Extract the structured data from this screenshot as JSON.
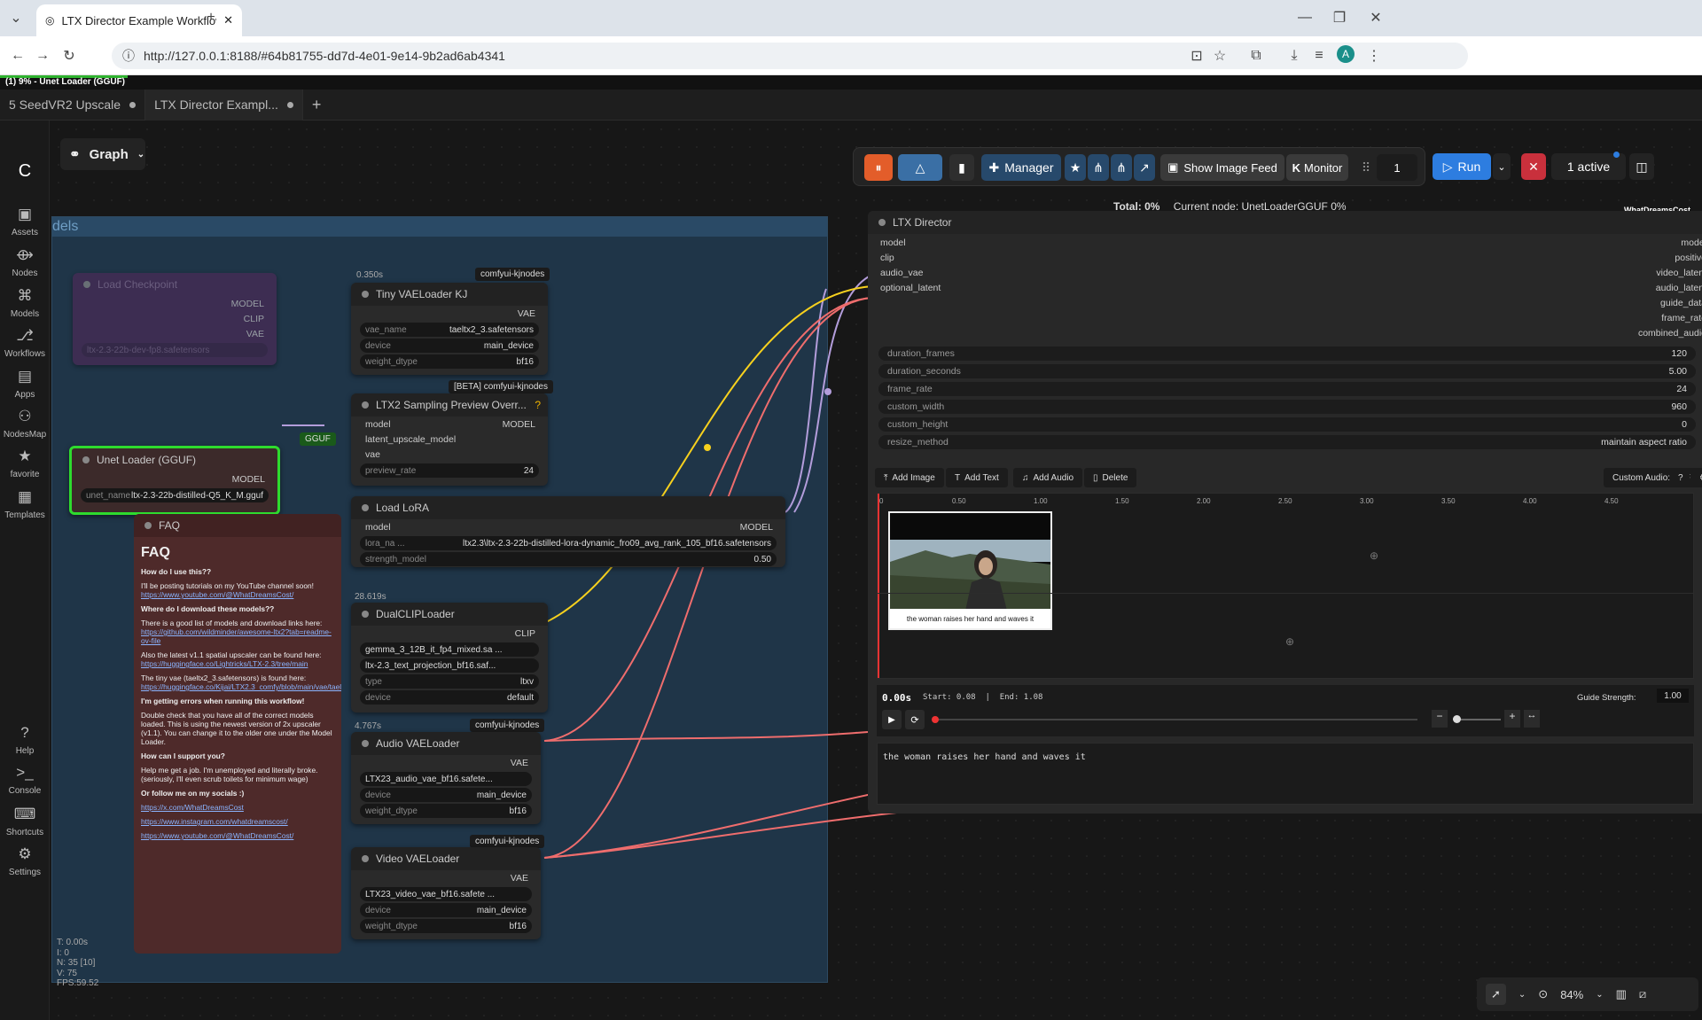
{
  "browser": {
    "tab_title": "LTX Director Example Workflow",
    "url": "http://127.0.0.1:8188/#64b81755-dd7d-4e01-9e14-9b2ad6ab4341",
    "profile": "A"
  },
  "progress": {
    "label": "(1) 9% - Unet Loader (GGUF)",
    "percent": 9
  },
  "workflow_tabs": [
    "5 SeedVR2 Upscale",
    "LTX Director Exampl..."
  ],
  "graph_label": "Graph",
  "sidebar": [
    {
      "label": "Assets",
      "icon": "assets-icon"
    },
    {
      "label": "Nodes",
      "icon": "nodes-icon"
    },
    {
      "label": "Models",
      "icon": "models-icon"
    },
    {
      "label": "Workflows",
      "icon": "workflows-icon"
    },
    {
      "label": "Apps",
      "icon": "apps-icon"
    },
    {
      "label": "NodesMap",
      "icon": "nodesmap-icon"
    },
    {
      "label": "favorite",
      "icon": "star-icon"
    },
    {
      "label": "Templates",
      "icon": "templates-icon"
    },
    {
      "label": "Help",
      "icon": "help-icon"
    },
    {
      "label": "Console",
      "icon": "console-icon"
    },
    {
      "label": "Shortcuts",
      "icon": "keyboard-icon"
    },
    {
      "label": "Settings",
      "icon": "gear-icon"
    }
  ],
  "toolbar": {
    "manager": "Manager",
    "image_feed": "Show Image Feed",
    "monitor": "Monitor",
    "queue_count": "1",
    "run": "Run",
    "active": "1 active"
  },
  "status": {
    "total": "Total: 0%",
    "current": "Current node: UnetLoaderGGUF 0%",
    "brand": "WhatDreamsCost"
  },
  "group_title": "dels",
  "nodes": {
    "load_checkpoint": {
      "title": "Load Checkpoint",
      "outputs": [
        "MODEL",
        "CLIP",
        "VAE"
      ],
      "ckpt": "ltx-2.3-22b-dev-fp8.safetensors"
    },
    "unet_loader": {
      "badge": "GGUF",
      "title": "Unet Loader (GGUF)",
      "output": "MODEL",
      "w_label": "unet_name",
      "w_value": "ltx-2.3-22b-distilled-Q5_K_M.gguf"
    },
    "tiny_vae": {
      "time": "0.350s",
      "tag": "comfyui-kjnodes",
      "title": "Tiny VAELoader KJ",
      "output": "VAE",
      "widgets": [
        [
          "vae_name",
          "taeltx2_3.safetensors"
        ],
        [
          "device",
          "main_device"
        ],
        [
          "weight_dtype",
          "bf16"
        ]
      ]
    },
    "ltx2_preview": {
      "tag": "[BETA] comfyui-kjnodes",
      "title": "LTX2 Sampling Preview Overr...",
      "inputs": [
        "model",
        "latent_upscale_model",
        "vae"
      ],
      "output": "MODEL",
      "widget": [
        "preview_rate",
        "24"
      ]
    },
    "load_lora": {
      "title": "Load LoRA",
      "input": "model",
      "output": "MODEL",
      "widgets": [
        [
          "lora_na ...",
          "ltx2.3\\ltx-2.3-22b-distilled-lora-dynamic_fro09_avg_rank_105_bf16.safetensors"
        ],
        [
          "strength_model",
          "0.50"
        ]
      ],
      "time": "28.619s"
    },
    "dual_clip": {
      "title": "DualCLIPLoader",
      "output": "CLIP",
      "widgets": [
        [
          "",
          "gemma_3_12B_it_fp4_mixed.sa ..."
        ],
        [
          "",
          "ltx-2.3_text_projection_bf16.saf..."
        ],
        [
          "type",
          "ltxv"
        ],
        [
          "device",
          "default"
        ]
      ]
    },
    "audio_vae": {
      "time": "4.767s",
      "tag": "comfyui-kjnodes",
      "title": "Audio VAELoader",
      "output": "VAE",
      "widgets": [
        [
          "",
          "LTX23_audio_vae_bf16.safete..."
        ],
        [
          "device",
          "main_device"
        ],
        [
          "weight_dtype",
          "bf16"
        ]
      ]
    },
    "video_vae": {
      "tag": "comfyui-kjnodes",
      "title": "Video VAELoader",
      "output": "VAE",
      "widgets": [
        [
          "",
          "LTX23_video_vae_bf16.safete ..."
        ],
        [
          "device",
          "main_device"
        ],
        [
          "weight_dtype",
          "bf16"
        ]
      ]
    }
  },
  "faq": {
    "title_small": "FAQ",
    "title": "FAQ",
    "items": [
      {
        "q": "How do I use this??",
        "a": "I'll be posting tutorials on my YouTube channel soon!",
        "link": "https://www.youtube.com/@WhatDreamsCost/"
      },
      {
        "q": "Where do I download these models??",
        "a": "There is a good list of models and download links here:",
        "link": "https://github.com/wildminder/awesome-ltx2?tab=readme-ov-file"
      },
      {
        "q": "",
        "a": "Also the latest v1.1 spatial upscaler can be found here:",
        "link": "https://huggingface.co/Lightricks/LTX-2.3/tree/main"
      },
      {
        "q": "",
        "a": "The tiny vae (taeltx2_3.safetensors) is found here:",
        "link": "https://huggingface.co/Kijai/LTX2.3_comfy/blob/main/vae/taeltx2_3.safetensors"
      },
      {
        "q": "I'm getting errors when running this workflow!",
        "a": "Double check that you have all of the correct models loaded. This is using the newest version of 2x upscaler (v1.1). You can change it to the older one under the Model Loader.",
        "link": ""
      },
      {
        "q": "How can I support you?",
        "a": "Help me get a job. I'm unemployed and literally broke. (seriously, I'll even scrub toilets for minimum wage)",
        "link": ""
      },
      {
        "q": "Or follow me on my socials :)",
        "a": "",
        "link": "https://x.com/WhatDreamsCost"
      }
    ],
    "extra_links": [
      "https://www.instagram.com/whatdreamscost/",
      "https://www.youtube.com/@WhatDreamsCost/"
    ]
  },
  "director": {
    "title": "LTX Director",
    "inputs": [
      "model",
      "clip",
      "audio_vae",
      "optional_latent"
    ],
    "outputs": [
      "model",
      "positive",
      "video_latent",
      "audio_latent",
      "guide_data",
      "frame_rate",
      "combined_audio"
    ],
    "widgets": [
      [
        "duration_frames",
        "120"
      ],
      [
        "duration_seconds",
        "5.00"
      ],
      [
        "frame_rate",
        "24"
      ],
      [
        "custom_width",
        "960"
      ],
      [
        "custom_height",
        "0"
      ],
      [
        "resize_method",
        "maintain aspect ratio"
      ]
    ],
    "buttons": [
      "Add Image",
      "Add Text",
      "Add Audio",
      "Delete"
    ],
    "custom_audio": "Custom Audio: OFF",
    "help": "?",
    "ruler": [
      "0",
      "0.50",
      "1.00",
      "1.50",
      "2.00",
      "2.50",
      "3.00",
      "3.50",
      "4.00",
      "4.50"
    ],
    "clip_caption": "the woman raises her hand and waves it",
    "time": "0.00s",
    "start_end": "Start: 0.08  |  End: 1.08",
    "guide_strength_label": "Guide Strength:",
    "guide_strength": "1.00",
    "prompt": "the woman raises her hand and waves it"
  },
  "stats": [
    "T: 0.00s",
    "I: 0",
    "N: 35 [10]",
    "V: 75",
    "FPS:59.52"
  ],
  "zoom": "84%"
}
